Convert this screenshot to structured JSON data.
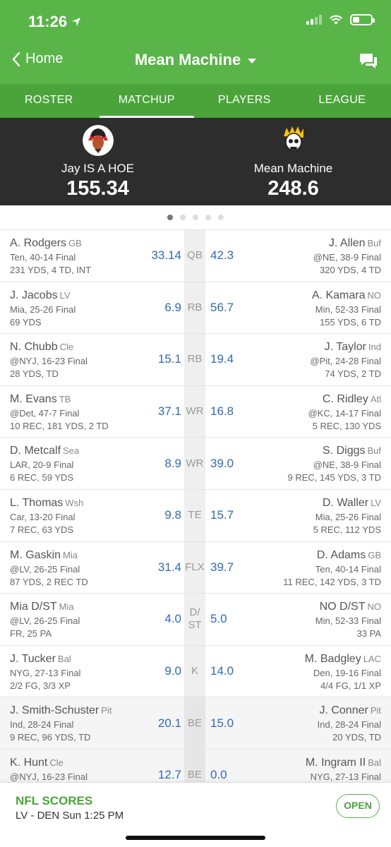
{
  "status": {
    "time": "11:26"
  },
  "nav": {
    "back_label": "Home",
    "title": "Mean Machine"
  },
  "tabs": [
    {
      "label": "ROSTER"
    },
    {
      "label": "MATCHUP"
    },
    {
      "label": "PLAYERS"
    },
    {
      "label": "LEAGUE"
    }
  ],
  "active_tab": "MATCHUP",
  "teams": {
    "left": {
      "name": "Jay IS A HOE",
      "score": "155.34",
      "avatar": "chief-avatar"
    },
    "right": {
      "name": "Mean Machine",
      "score": "248.6",
      "avatar": "skull-avatar"
    }
  },
  "pager": {
    "count": 5,
    "active": 1
  },
  "rows": [
    {
      "slot": "QB",
      "bench": false,
      "left": {
        "name": "A. Rodgers",
        "team": "GB",
        "game": "Ten, 40-14 Final",
        "stats": "231 YDS, 4 TD, INT",
        "pts": "33.14"
      },
      "right": {
        "name": "J. Allen",
        "team": "Buf",
        "game": "@NE, 38-9 Final",
        "stats": "320 YDS, 4 TD",
        "pts": "42.3"
      }
    },
    {
      "slot": "RB",
      "bench": false,
      "left": {
        "name": "J. Jacobs",
        "team": "LV",
        "game": "Mia, 25-26 Final",
        "stats": "69 YDS",
        "pts": "6.9"
      },
      "right": {
        "name": "A. Kamara",
        "team": "NO",
        "game": "Min, 52-33 Final",
        "stats": "155 YDS, 6 TD",
        "pts": "56.7"
      }
    },
    {
      "slot": "RB",
      "bench": false,
      "left": {
        "name": "N. Chubb",
        "team": "Cle",
        "game": "@NYJ, 16-23 Final",
        "stats": "28 YDS, TD",
        "pts": "15.1"
      },
      "right": {
        "name": "J. Taylor",
        "team": "Ind",
        "game": "@Pit, 24-28 Final",
        "stats": "74 YDS, 2 TD",
        "pts": "19.4"
      }
    },
    {
      "slot": "WR",
      "bench": false,
      "left": {
        "name": "M. Evans",
        "team": "TB",
        "game": "@Det, 47-7 Final",
        "stats": "10 REC, 181 YDS, 2 TD",
        "pts": "37.1"
      },
      "right": {
        "name": "C. Ridley",
        "team": "Atl",
        "game": "@KC, 14-17 Final",
        "stats": "5 REC, 130 YDS",
        "pts": "16.8"
      }
    },
    {
      "slot": "WR",
      "bench": false,
      "left": {
        "name": "D. Metcalf",
        "team": "Sea",
        "game": "LAR, 20-9 Final",
        "stats": "6 REC, 59 YDS",
        "pts": "8.9"
      },
      "right": {
        "name": "S. Diggs",
        "team": "Buf",
        "game": "@NE, 38-9 Final",
        "stats": "9 REC, 145 YDS, 3 TD",
        "pts": "39.0"
      }
    },
    {
      "slot": "TE",
      "bench": false,
      "left": {
        "name": "L. Thomas",
        "team": "Wsh",
        "game": "Car, 13-20 Final",
        "stats": "7 REC, 63 YDS",
        "pts": "9.8"
      },
      "right": {
        "name": "D. Waller",
        "team": "LV",
        "game": "Mia, 25-26 Final",
        "stats": "5 REC, 112 YDS",
        "pts": "15.7"
      }
    },
    {
      "slot": "FLX",
      "bench": false,
      "left": {
        "name": "M. Gaskin",
        "team": "Mia",
        "game": "@LV, 26-25 Final",
        "stats": "87 YDS, 2 REC TD",
        "pts": "31.4"
      },
      "right": {
        "name": "D. Adams",
        "team": "GB",
        "game": "Ten, 40-14 Final",
        "stats": "11 REC, 142 YDS, 3 TD",
        "pts": "39.7"
      }
    },
    {
      "slot": "D/ ST",
      "bench": false,
      "left": {
        "name": "Mia D/ST",
        "team": "Mia",
        "game": "@LV, 26-25 Final",
        "stats": "FR, 25 PA",
        "pts": "4.0"
      },
      "right": {
        "name": "NO D/ST",
        "team": "NO",
        "game": "Min, 52-33 Final",
        "stats": "33 PA",
        "pts": "5.0"
      }
    },
    {
      "slot": "K",
      "bench": false,
      "left": {
        "name": "J. Tucker",
        "team": "Bal",
        "game": "NYG, 27-13 Final",
        "stats": "2/2 FG, 3/3 XP",
        "pts": "9.0"
      },
      "right": {
        "name": "M. Badgley",
        "team": "LAC",
        "game": "Den, 19-16 Final",
        "stats": "4/4 FG, 1/1 XP",
        "pts": "14.0"
      }
    },
    {
      "slot": "BE",
      "bench": true,
      "left": {
        "name": "J. Smith-Schuster",
        "team": "Pit",
        "game": "Ind, 28-24 Final",
        "stats": "9 REC, 96 YDS, TD",
        "pts": "20.1"
      },
      "right": {
        "name": "J. Conner",
        "team": "Pit",
        "game": "Ind, 28-24 Final",
        "stats": "20 YDS, TD",
        "pts": "15.0"
      }
    },
    {
      "slot": "BE",
      "bench": true,
      "left": {
        "name": "K. Hunt",
        "team": "Cle",
        "game": "@NYJ, 16-23 Final",
        "stats": "",
        "pts": "12.7"
      },
      "right": {
        "name": "M. Ingram II",
        "team": "Bal",
        "game": "NYG, 27-13 Final",
        "stats": "",
        "pts": "0.0"
      }
    }
  ],
  "footer": {
    "title": "NFL SCORES",
    "subtitle": "LV - DEN   Sun 1:25 PM",
    "open_label": "OPEN"
  },
  "colors": {
    "brand_green": "#59b548",
    "tab_green": "#4aa43a",
    "score_bg": "#2d2d2d",
    "points_blue": "#2f6ab3"
  }
}
